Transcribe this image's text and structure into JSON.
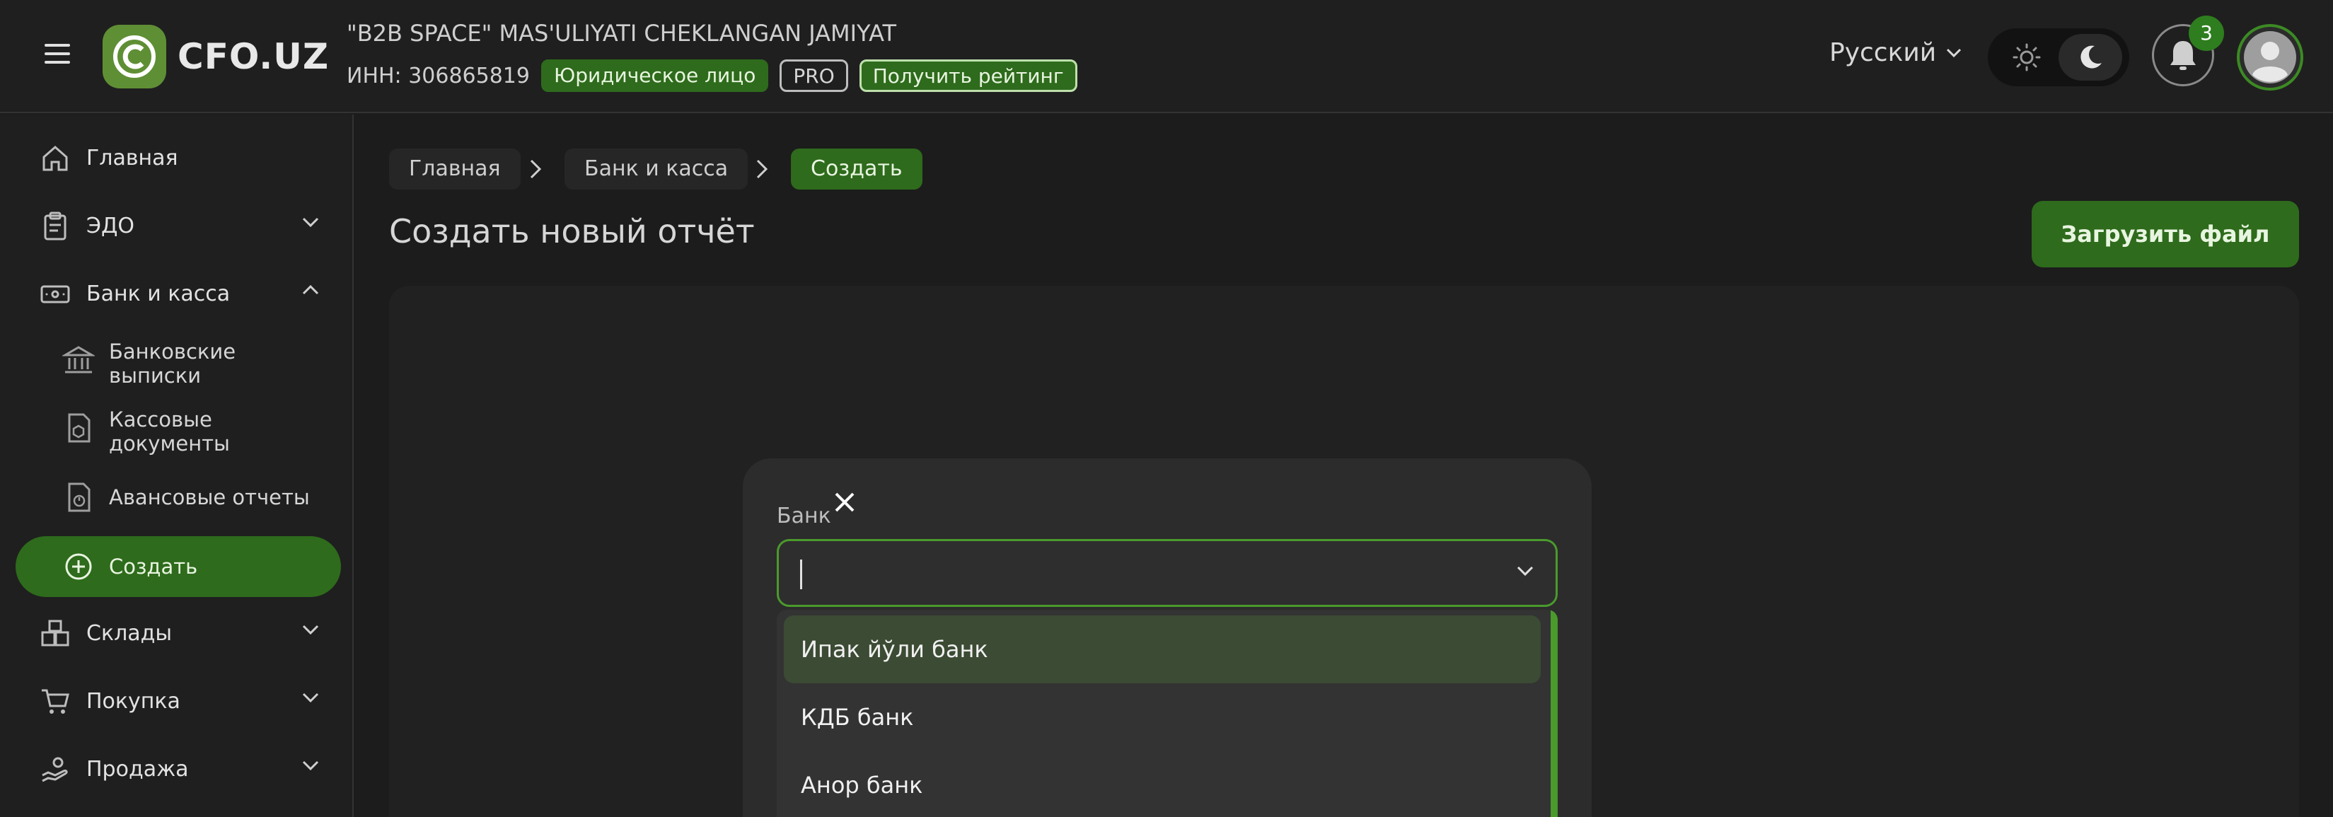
{
  "header": {
    "logo_text": "CFO.UZ",
    "company_name": "\"B2B SPACE\" MAS'ULIYATI CHEKLANGAN JAMIYAT",
    "inn": "ИНН: 306865819",
    "entity_badge": "Юридическое лицо",
    "pro_badge": "PRO",
    "rating_button": "Получить рейтинг",
    "language": "Русский",
    "notifications_count": "3"
  },
  "sidebar": {
    "items": [
      {
        "label": "Главная",
        "icon": "home-icon"
      },
      {
        "label": "ЭДО",
        "icon": "clipboard-icon"
      },
      {
        "label": "Банк и касса",
        "icon": "cash-icon"
      },
      {
        "label": "Банковские выписки",
        "icon": "bank-icon"
      },
      {
        "label": "Кассовые документы",
        "icon": "cash-document-icon"
      },
      {
        "label": "Авансовые отчеты",
        "icon": "advance-report-icon"
      },
      {
        "label": "Создать",
        "icon": "plus-circle-icon"
      },
      {
        "label": "Склады",
        "icon": "warehouse-icon"
      },
      {
        "label": "Покупка",
        "icon": "cart-icon"
      },
      {
        "label": "Продажа",
        "icon": "sale-icon"
      }
    ],
    "sub_lines": {
      "bank_statements": [
        "Банковские",
        "выписки"
      ],
      "cash_documents": [
        "Кассовые",
        "документы"
      ]
    }
  },
  "breadcrumb": [
    "Главная",
    "Банк и касса",
    "Создать"
  ],
  "page_title": "Создать новый отчёт",
  "upload_button": "Загрузить файл",
  "modal": {
    "field_label": "Банк",
    "input_value": "",
    "options": [
      "Ипак йўли банк",
      "КДБ банк",
      "Анор банк"
    ]
  },
  "colors": {
    "accent": "#2e6b1c",
    "accent_border": "#4a9a2c",
    "background": "#1c1c1c"
  }
}
